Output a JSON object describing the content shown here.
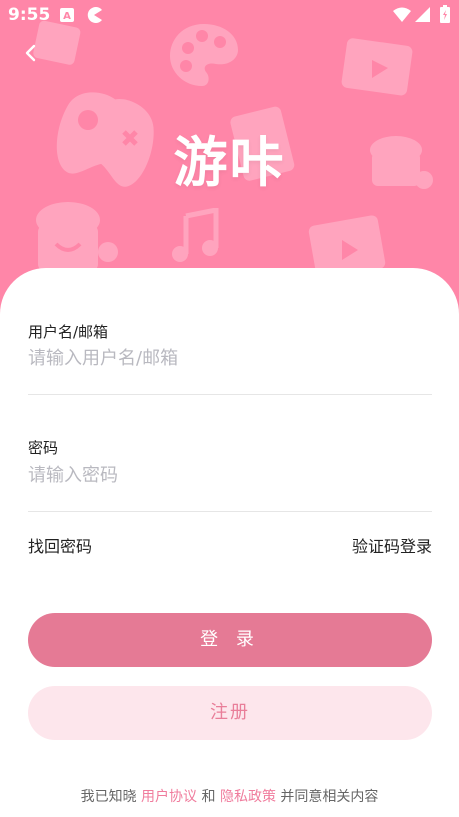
{
  "status_bar": {
    "time": "9:55",
    "icons": [
      "a-icon",
      "pacman-icon",
      "wifi-icon",
      "signal-icon",
      "battery-icon"
    ]
  },
  "header": {
    "back_icon": "chevron-left-icon",
    "title": "游咔",
    "background_color": "#ff86a8"
  },
  "form": {
    "username_label": "用户名/邮箱",
    "username_placeholder": "请输入用户名/邮箱",
    "password_label": "密码",
    "password_placeholder": "请输入密码",
    "forgot_password": "找回密码",
    "sms_login": "验证码登录"
  },
  "buttons": {
    "login": "登 录",
    "register": "注册",
    "login_color": "#e57a95",
    "register_color": "#fde6ec"
  },
  "agreement": {
    "prefix": "我已知晓",
    "user_agreement": "用户协议",
    "and": "和",
    "privacy_policy": "隐私政策",
    "suffix": "并同意相关内容"
  }
}
